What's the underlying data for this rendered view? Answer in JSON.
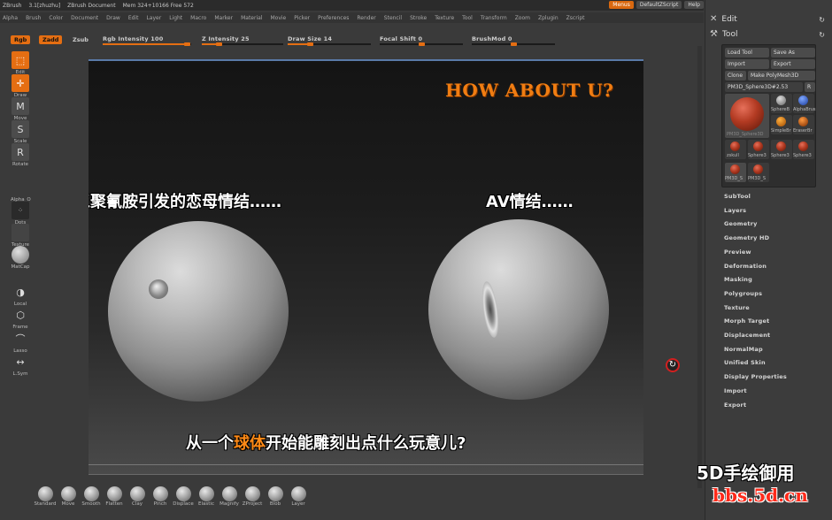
{
  "titlebar": {
    "app": "ZBrush",
    "version": "3.1[zhuzhu]",
    "doc": "ZBrush Document",
    "mem": "Mem 324+10166 Free 572",
    "buttons": [
      "Menus",
      "DefaultZScript",
      "Help"
    ]
  },
  "menu": [
    "Alpha",
    "Brush",
    "Color",
    "Document",
    "Draw",
    "Edit",
    "Layer",
    "Light",
    "Macro",
    "Marker",
    "Material",
    "Movie",
    "Picker",
    "Preferences",
    "Render",
    "Stencil",
    "Stroke",
    "Texture",
    "Tool",
    "Transform",
    "Zoom",
    "Zplugin",
    "Zscript"
  ],
  "toolbar": {
    "rgb": "Rgb",
    "zadd": "Zadd",
    "zsub": "Zsub",
    "rgb_intensity": "Rgb Intensity 100",
    "z_intensity": "Z Intensity 25",
    "draw_size": "Draw Size 14",
    "focal_shift": "Focal Shift 0",
    "brushmod": "BrushMod 0",
    "rgb_intensity_value": 100,
    "z_intensity_value": 25,
    "draw_size_value": 14,
    "focal_shift_value": 0,
    "brushmod_value": 0
  },
  "left_tools": [
    {
      "label": "Edit",
      "icon": "edit-icon",
      "active": true
    },
    {
      "label": "Draw",
      "icon": "draw-icon",
      "active": true
    },
    {
      "label": "Move",
      "icon": "move-icon",
      "active": false
    },
    {
      "label": "Scale",
      "icon": "scale-icon",
      "active": false
    },
    {
      "label": "Rotate",
      "icon": "rotate-icon",
      "active": false
    },
    {
      "label": "Alpha_O",
      "icon": "alpha-icon",
      "active": false
    },
    {
      "label": "Dots",
      "icon": "dots-icon",
      "active": false
    },
    {
      "label": "Texture",
      "icon": "texture-icon",
      "active": false
    },
    {
      "label": "MatCap",
      "icon": "matcap-icon",
      "active": false
    },
    {
      "label": "Local",
      "icon": "local-icon",
      "active": false
    },
    {
      "label": "Frame",
      "icon": "frame-icon",
      "active": false
    },
    {
      "label": "Lasso",
      "icon": "lasso-icon",
      "active": false
    },
    {
      "label": "L.Sym",
      "icon": "lsym-icon",
      "active": false
    }
  ],
  "canvas": {
    "title": "HOW ABOUT U?",
    "caption_left": "由三聚氰胺引发的恋母情结……",
    "caption_right": "AV情结……",
    "bottom_pre": "从一个",
    "bottom_hl": "球体",
    "bottom_post": "开始能雕刻出点什么玩意儿?"
  },
  "right_panel": {
    "edit": "Edit",
    "tool": "Tool",
    "buttons": [
      "Load Tool",
      "Save As",
      "Import",
      "Export",
      "Clone",
      "Make PolyMesh3D"
    ],
    "current_tool": "PM3D_Sphere3D#2.53",
    "r_btn": "R",
    "thumbs": [
      "PM3D_Sphere3D",
      "SphereB",
      "AlphaBrus",
      "SimpleBr",
      "EraserBr",
      "zskull",
      "Sphere3",
      "Sphere3",
      "Sphere3",
      "PM3D_S",
      "PM3D_S"
    ],
    "subpalettes": [
      "SubTool",
      "Layers",
      "Geometry",
      "Geometry HD",
      "Preview",
      "Deformation",
      "Masking",
      "Polygroups",
      "Texture",
      "Morph Target",
      "Displacement",
      "NormalMap",
      "Unified Skin",
      "Display Properties",
      "Import",
      "Export"
    ]
  },
  "brushes": [
    "Standard",
    "Move",
    "Smooth",
    "Flatten",
    "Clay",
    "Pinch",
    "Displace",
    "Elastic",
    "Magnify",
    "ZProject",
    "Blob",
    "Layer"
  ],
  "watermark": {
    "line1": "5D手绘御用",
    "line2": "bbs.5d.cn"
  },
  "colors": {
    "accent": "#e56e12",
    "title": "#f07d12",
    "watermark_red": "#ff2a1a"
  }
}
